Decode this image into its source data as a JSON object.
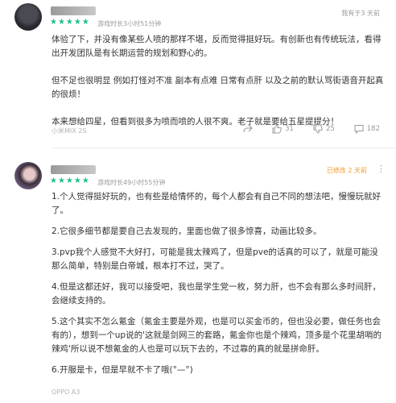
{
  "reviews": [
    {
      "stars": "★★★★★",
      "meta": "游戏时长3小时51分钟",
      "time": "我有于3 天前",
      "paragraphs": [
        "体验了下，并没有像某些人喷的那样不堪，反而觉得挺好玩。有创新也有传统玩法，看得出开发团队是有长期运营的规划和野心的。",
        "但不足也很明显 例如打怪对不准 副本有点难 日常有点肝 以及之前的默认骂街语音开起真的很烦！",
        "本来想给四星，但看到很多为喷而喷的人很不爽。老子就是要给五星提提分！"
      ],
      "device": "小米MIX 2S",
      "actions": {
        "share": "",
        "like": "31",
        "dislike": "25",
        "comment": "182"
      }
    },
    {
      "stars": "★★★★★",
      "meta": "游戏时长49小时55分钟",
      "time": "已修改 2 天前",
      "paragraphs": [
        "1.个人觉得挺好玩的，也有些是给情怀的，每个人都会有自己不同的想法吧，慢慢玩就好了。",
        "2.它很多细节都是要自己去发现的，里面也做了很多惊喜，动画比较多。",
        "3.pvp我个人感觉不大好打，可能是我太辣鸡了，但是pve的话真的可以了，就是可能没那么简单，特别是白帝城，根本打不过，哭了。",
        "4.但是这都还好，我可以接受吧，我也是学生党一枚，努力肝，也不会有那么多时间肝，会继续支持的。",
        "5.这个其实不怎么氪金（氪金主要是外观，也是可以买金币的，但也没必要，做任务也会有的），想到一个up说的'这就是剑网三的套路，氪金你也是个辣鸡，顶多是个花里胡哨的辣鸡'所以说不想氪金的人也是可以玩下去的，不过靠的真的就是拼命肝。",
        "6.开服是卡，但是早就不卡了哦(°—°)"
      ],
      "device": "OPPO A3"
    }
  ]
}
